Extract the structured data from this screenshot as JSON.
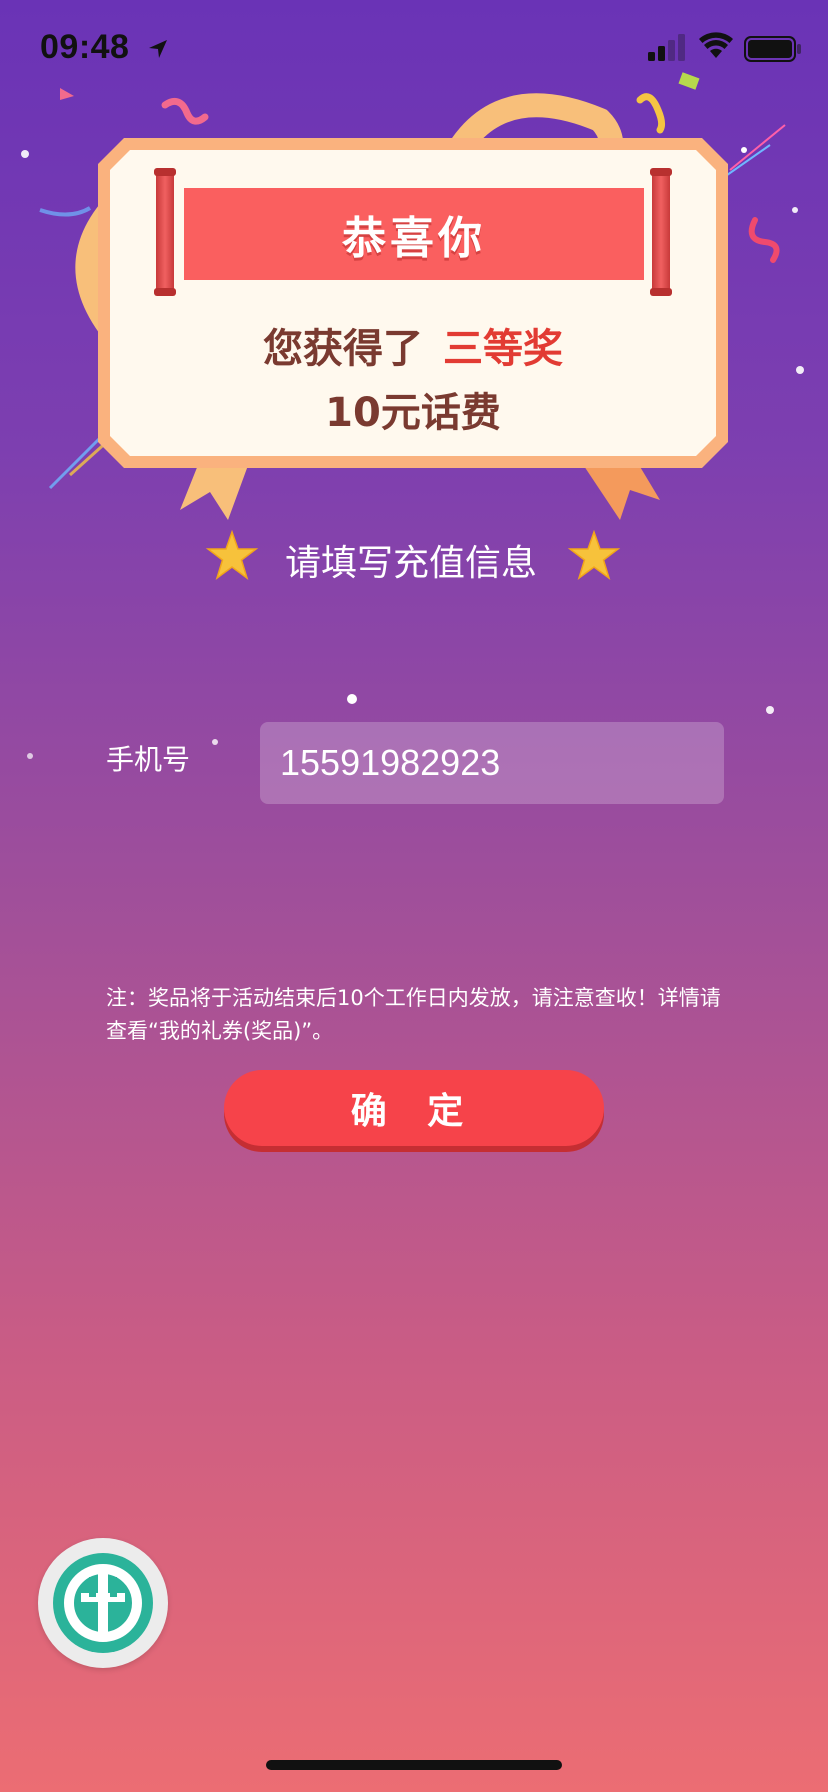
{
  "status_bar": {
    "time": "09:48",
    "icons": [
      "location-arrow-icon",
      "cellular-signal-icon",
      "wifi-icon",
      "battery-icon"
    ]
  },
  "card": {
    "banner": "恭喜你",
    "win_prefix": "您获得了",
    "prize_level": "三等奖",
    "prize_amount": "10元话费"
  },
  "form": {
    "section_title": "请填写充值信息",
    "phone_label": "手机号",
    "phone_value": "15591982923"
  },
  "note": "注：奖品将于活动结束后10个工作日内发放，请注意查收！详情请查看“我的礼券(奖品)”。",
  "confirm_label": "确 定",
  "floating_button": {
    "icon": "bank-logo-icon"
  },
  "colors": {
    "background_top": "#6a33b6",
    "background_bottom": "#ec6d73",
    "banner": "#fa5f5f",
    "prize_text": "#e23b33",
    "confirm_button": "#f6434a",
    "logo_teal": "#2bb39a"
  }
}
